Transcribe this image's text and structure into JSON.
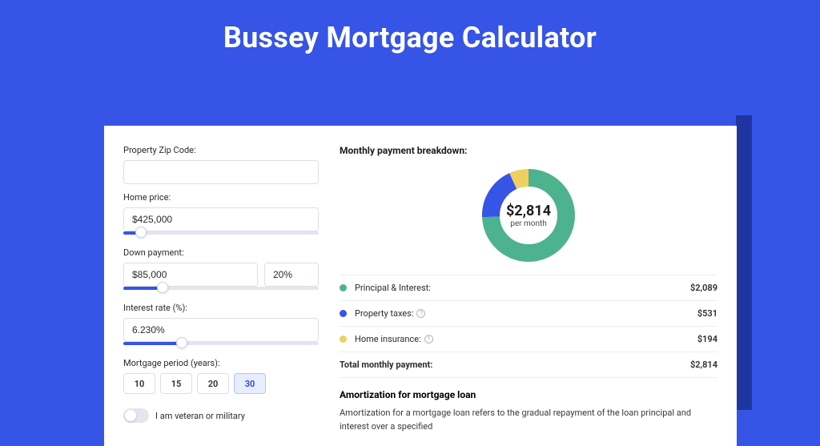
{
  "title": "Bussey Mortgage Calculator",
  "form": {
    "zip_label": "Property Zip Code:",
    "zip_value": "",
    "price_label": "Home price:",
    "price_value": "$425,000",
    "price_slider_pct": 9,
    "down_label": "Down payment:",
    "down_value": "$85,000",
    "down_pct": "20%",
    "down_slider_pct": 20,
    "rate_label": "Interest rate (%):",
    "rate_value": "6.230%",
    "rate_slider_pct": 30,
    "period_label": "Mortgage period (years):",
    "periods": [
      "10",
      "15",
      "20",
      "30"
    ],
    "period_active": 3,
    "veteran_label": "I am veteran or military"
  },
  "breakdown": {
    "title": "Monthly payment breakdown:",
    "center_value": "$2,814",
    "center_sub": "per month",
    "items": [
      {
        "label": "Principal & Interest:",
        "value": "$2,089",
        "color": "#4db38e",
        "info": false
      },
      {
        "label": "Property taxes:",
        "value": "$531",
        "color": "#3654e6",
        "info": true
      },
      {
        "label": "Home insurance:",
        "value": "$194",
        "color": "#efcf5f",
        "info": true
      }
    ],
    "total_label": "Total monthly payment:",
    "total_value": "$2,814"
  },
  "amort": {
    "title": "Amortization for mortgage loan",
    "text": "Amortization for a mortgage loan refers to the gradual repayment of the loan principal and interest over a specified"
  },
  "chart_data": {
    "type": "pie",
    "title": "Monthly payment breakdown",
    "series": [
      {
        "name": "Principal & Interest",
        "value": 2089,
        "color": "#4db38e"
      },
      {
        "name": "Property taxes",
        "value": 531,
        "color": "#3654e6"
      },
      {
        "name": "Home insurance",
        "value": 194,
        "color": "#efcf5f"
      }
    ],
    "total": 2814,
    "unit": "USD/month"
  }
}
